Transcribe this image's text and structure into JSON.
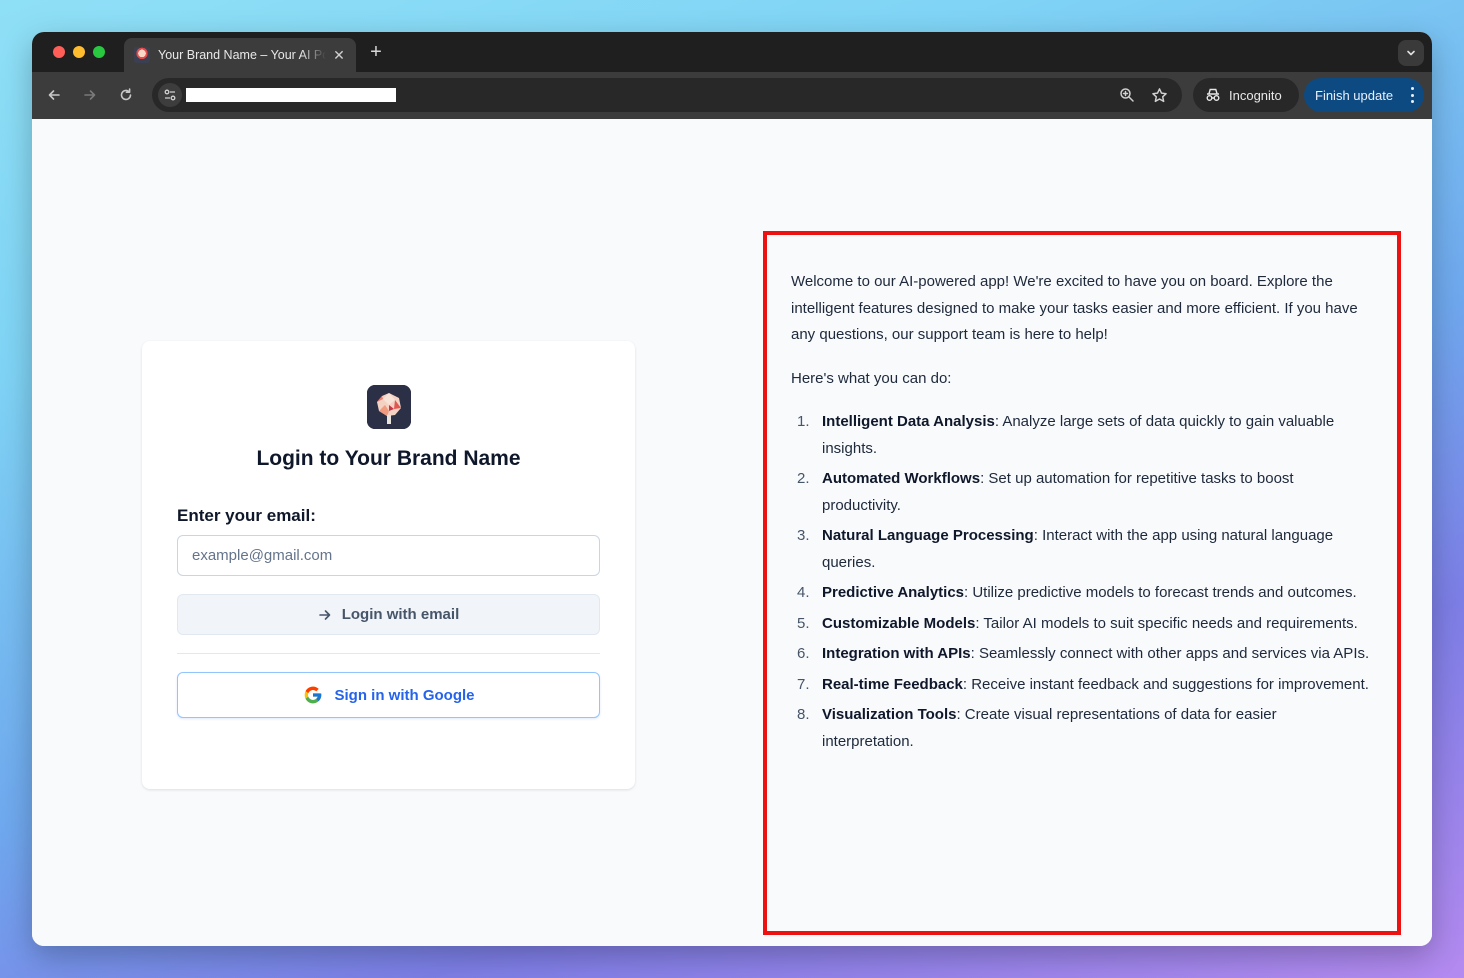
{
  "browser": {
    "tab": {
      "title": "Your Brand Name – Your AI Powered App"
    },
    "incognito_label": "Incognito",
    "finish_update_label": "Finish update"
  },
  "login": {
    "title": "Login to Your Brand Name",
    "email_label": "Enter your email:",
    "email_placeholder": "example@gmail.com",
    "email_value": "",
    "login_button": "Login with email",
    "google_button": "Sign in with Google"
  },
  "info": {
    "intro": "Welcome to our AI-powered app! We're excited to have you on board. Explore the intelligent features designed to make your tasks easier and more efficient. If you have any questions, our support team is here to help!",
    "subheading": "Here's what you can do:",
    "features": [
      {
        "num": "1.",
        "title": "Intelligent Data Analysis",
        "desc": ": Analyze large sets of data quickly to gain valuable insights."
      },
      {
        "num": "2.",
        "title": "Automated Workflows",
        "desc": ": Set up automation for repetitive tasks to boost productivity."
      },
      {
        "num": "3.",
        "title": "Natural Language Processing",
        "desc": ": Interact with the app using natural language queries."
      },
      {
        "num": "4.",
        "title": "Predictive Analytics",
        "desc": ": Utilize predictive models to forecast trends and outcomes."
      },
      {
        "num": "5.",
        "title": "Customizable Models",
        "desc": ": Tailor AI models to suit specific needs and requirements."
      },
      {
        "num": "6.",
        "title": "Integration with APIs",
        "desc": ": Seamlessly connect with other apps and services via APIs."
      },
      {
        "num": "7.",
        "title": "Real-time Feedback",
        "desc": ": Receive instant feedback and suggestions for improvement."
      },
      {
        "num": "8.",
        "title": "Visualization Tools",
        "desc": ": Create visual representations of data for easier interpretation."
      }
    ]
  },
  "colors": {
    "highlight_border": "#ee1111",
    "google_blue": "#2563eb",
    "finish_update_bg": "#0d4a82"
  }
}
